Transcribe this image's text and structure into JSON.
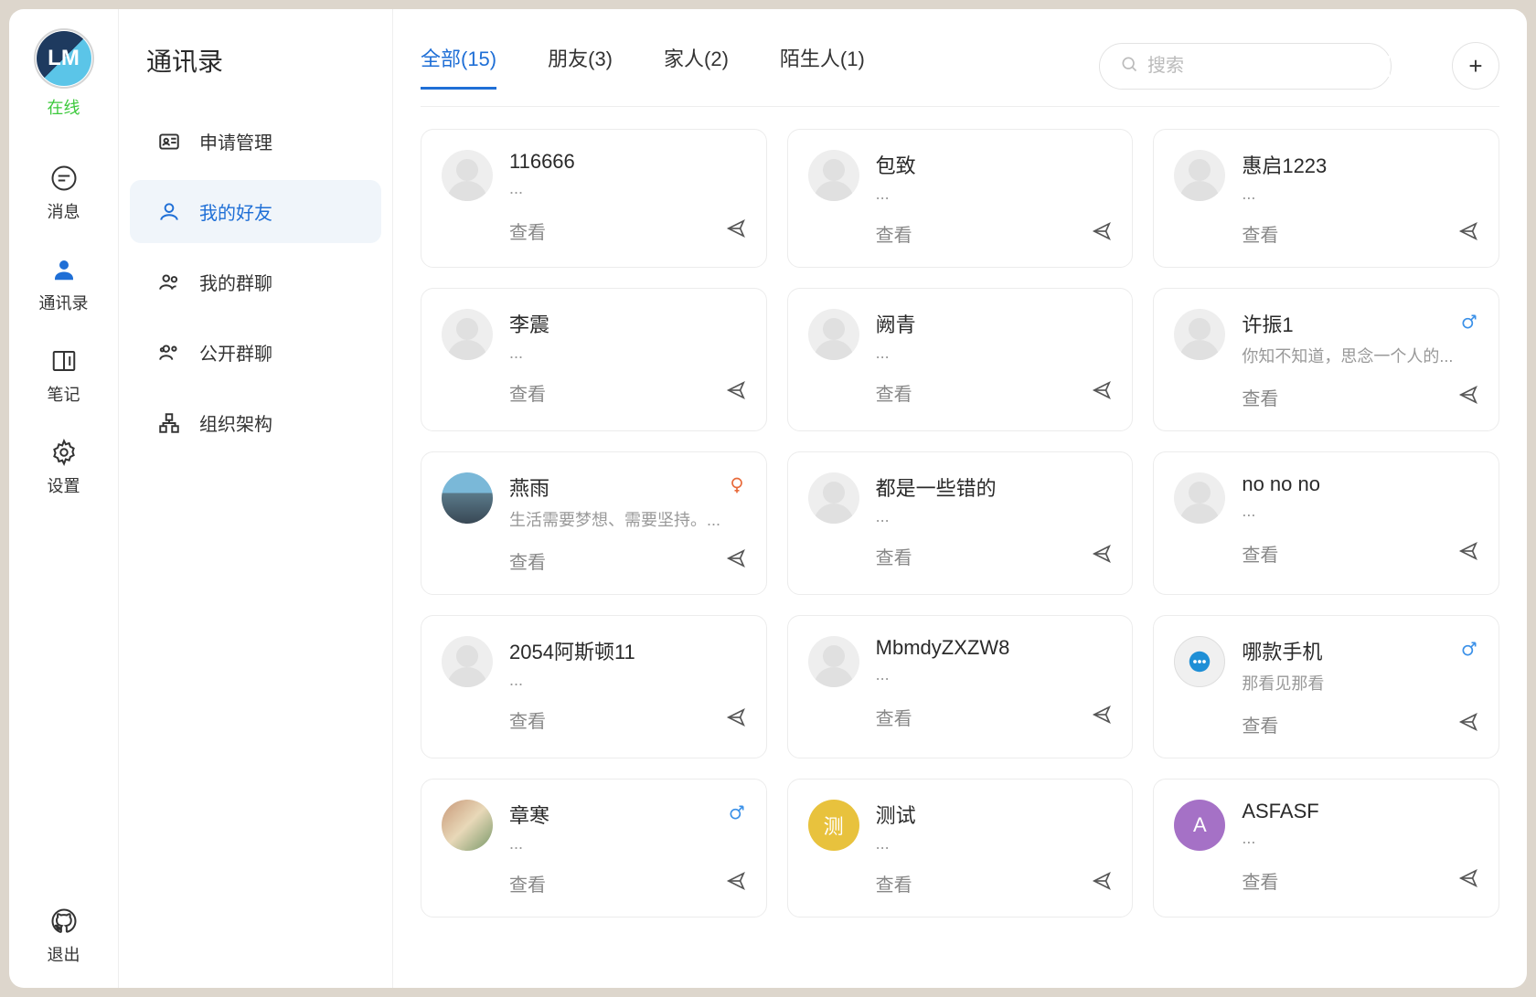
{
  "rail": {
    "avatar_text": "LM",
    "status": "在线",
    "items": [
      {
        "id": "messages",
        "label": "消息"
      },
      {
        "id": "contacts",
        "label": "通讯录"
      },
      {
        "id": "notes",
        "label": "笔记"
      },
      {
        "id": "settings",
        "label": "设置"
      }
    ],
    "logout": "退出",
    "active_index": 1
  },
  "sidebar": {
    "title": "通讯录",
    "items": [
      {
        "id": "apply",
        "label": "申请管理"
      },
      {
        "id": "friends",
        "label": "我的好友"
      },
      {
        "id": "groups",
        "label": "我的群聊"
      },
      {
        "id": "public",
        "label": "公开群聊"
      },
      {
        "id": "org",
        "label": "组织架构"
      }
    ],
    "active_index": 1
  },
  "main": {
    "tabs": [
      {
        "label": "全部(15)"
      },
      {
        "label": "朋友(3)"
      },
      {
        "label": "家人(2)"
      },
      {
        "label": "陌生人(1)"
      }
    ],
    "active_tab": 0,
    "search_placeholder": "搜索",
    "view_label": "查看",
    "contacts": [
      {
        "name": "116666",
        "status": "...",
        "avatar_type": "silhouette",
        "gender": null
      },
      {
        "name": "包致",
        "status": "...",
        "avatar_type": "silhouette",
        "gender": null
      },
      {
        "name": "惠启1223",
        "status": "...",
        "avatar_type": "silhouette",
        "gender": null
      },
      {
        "name": "李震",
        "status": "...",
        "avatar_type": "silhouette",
        "gender": null
      },
      {
        "name": "阙青",
        "status": "...",
        "avatar_type": "silhouette",
        "gender": null
      },
      {
        "name": "许振1",
        "status": "你知不知道，思念一个人的...",
        "avatar_type": "silhouette",
        "gender": "male"
      },
      {
        "name": "燕雨",
        "status": "生活需要梦想、需要坚持。...",
        "avatar_type": "photo-city",
        "gender": "female"
      },
      {
        "name": "都是一些错的",
        "status": "...",
        "avatar_type": "silhouette",
        "gender": null
      },
      {
        "name": "no no no",
        "status": "...",
        "avatar_type": "silhouette",
        "gender": null
      },
      {
        "name": "2054阿斯顿11",
        "status": "...",
        "avatar_type": "silhouette",
        "gender": null
      },
      {
        "name": "MbmdyZXZW8",
        "status": "...",
        "avatar_type": "silhouette",
        "gender": null
      },
      {
        "name": "哪款手机",
        "status": "那看见那看",
        "avatar_type": "chat-bubble",
        "gender": "male"
      },
      {
        "name": "章寒",
        "status": "...",
        "avatar_type": "photo-couple",
        "gender": "male"
      },
      {
        "name": "测试",
        "status": "...",
        "avatar_type": "letter",
        "letter": "测",
        "bg": "#e8c23d"
      },
      {
        "name": "ASFASF",
        "status": "...",
        "avatar_type": "letter",
        "letter": "A",
        "bg": "#a571c6"
      }
    ]
  }
}
